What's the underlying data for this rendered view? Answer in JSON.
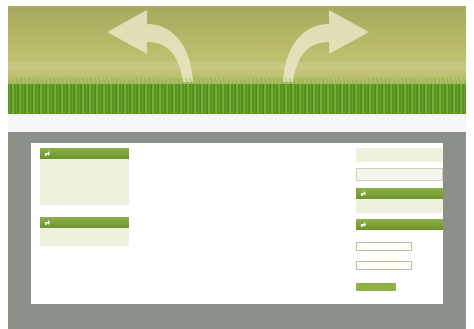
{
  "header": {
    "site_title": ""
  },
  "colors": {
    "header_olive": "#b8b968",
    "grass_green": "#5f8a2a",
    "box_title_green": "#7fa43c",
    "frame_gray": "#8b9088",
    "box_body_tint": "#eef1dd"
  },
  "left": {
    "box1": {
      "title": "",
      "links": [
        "",
        "",
        "",
        ""
      ]
    },
    "box2": {
      "title": "",
      "links": [
        ""
      ]
    }
  },
  "main": {
    "title": "",
    "lines": [
      "",
      "",
      "",
      "",
      ""
    ]
  },
  "right": {
    "search_placeholder": "",
    "box1": {
      "title": "",
      "text": ""
    },
    "box2": {
      "title": "",
      "username_label": "",
      "password_label": "",
      "remember_label": "",
      "login_button": "",
      "links": [
        "",
        ""
      ]
    }
  },
  "footer": {
    "text": ""
  }
}
